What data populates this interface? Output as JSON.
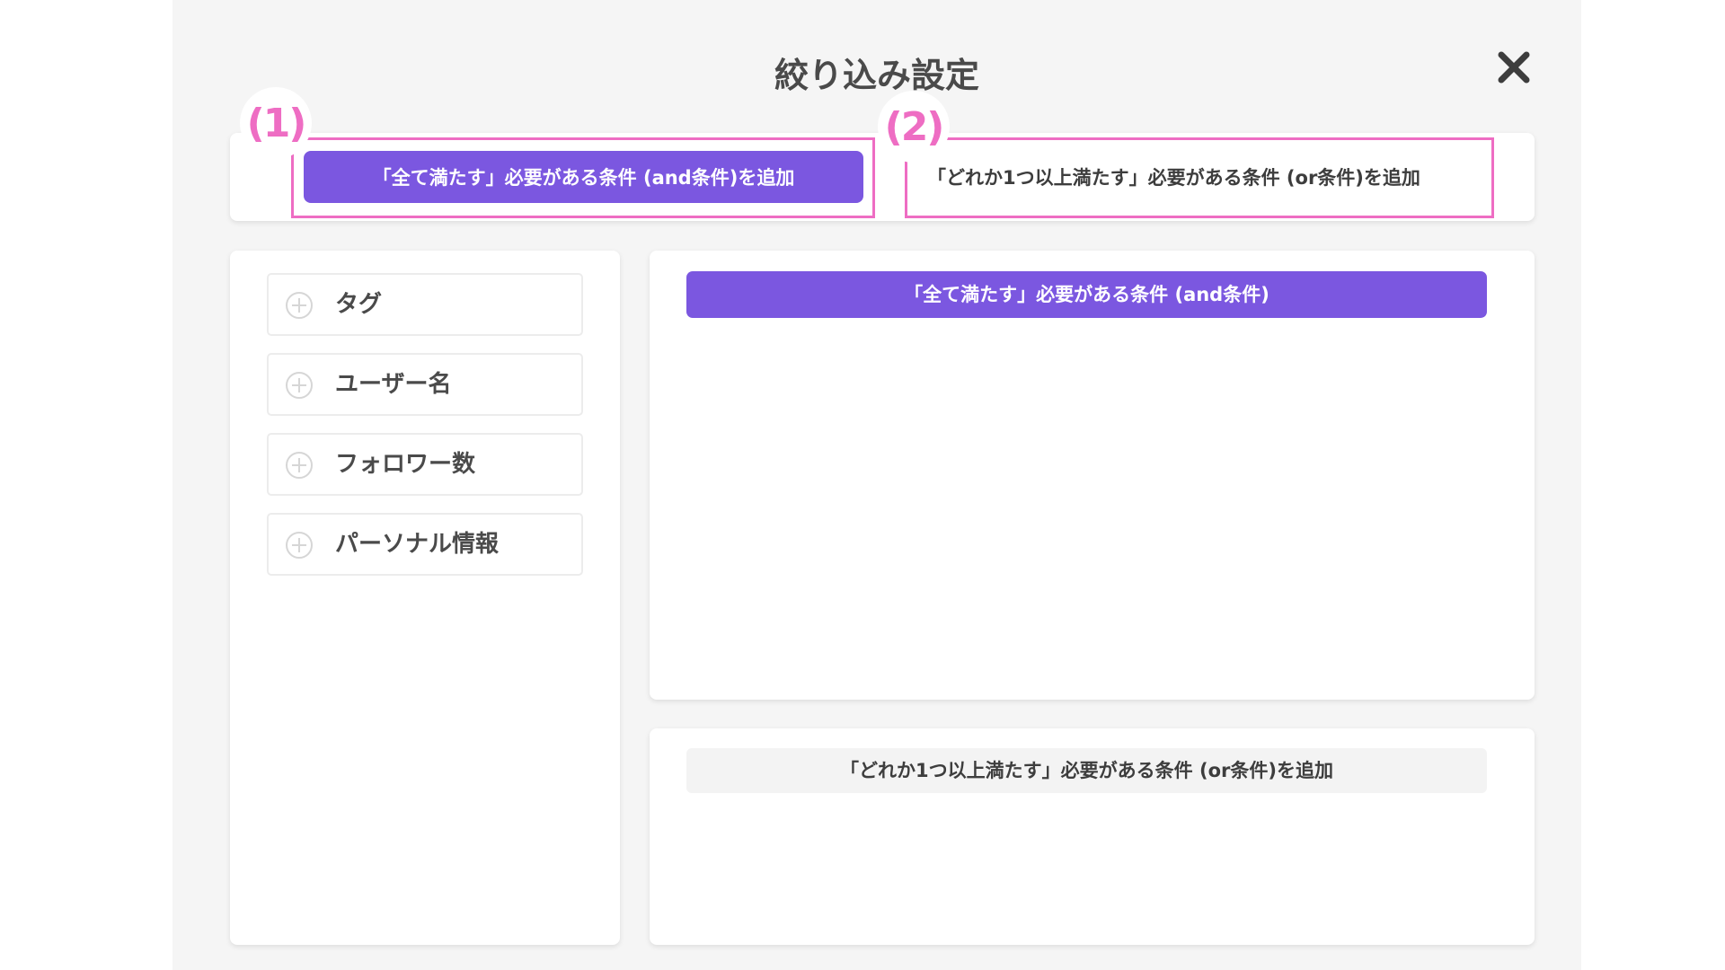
{
  "modal": {
    "title": "絞り込み設定"
  },
  "callouts": {
    "first": "(1)",
    "second": "(2)"
  },
  "toolbar": {
    "and_add_label": "「全て満たす」必要がある条件 (and条件)を追加",
    "or_add_label": "「どれか1つ以上満たす」必要がある条件 (or条件)を追加"
  },
  "filters": {
    "items": [
      {
        "label": "タグ",
        "icon": "plus-circle-icon"
      },
      {
        "label": "ユーザー名",
        "icon": "plus-circle-icon"
      },
      {
        "label": "フォロワー数",
        "icon": "plus-circle-icon"
      },
      {
        "label": "パーソナル情報",
        "icon": "plus-circle-icon"
      }
    ]
  },
  "and_panel": {
    "header": "「全て満たす」必要がある条件 (and条件)"
  },
  "or_panel": {
    "add_label": "「どれか1つ以上満たす」必要がある条件 (or条件)を追加"
  },
  "colors": {
    "accent": "#7b57e0",
    "highlight": "#ee6dc3",
    "background": "#f5f5f5",
    "text": "#4a4a4a"
  }
}
